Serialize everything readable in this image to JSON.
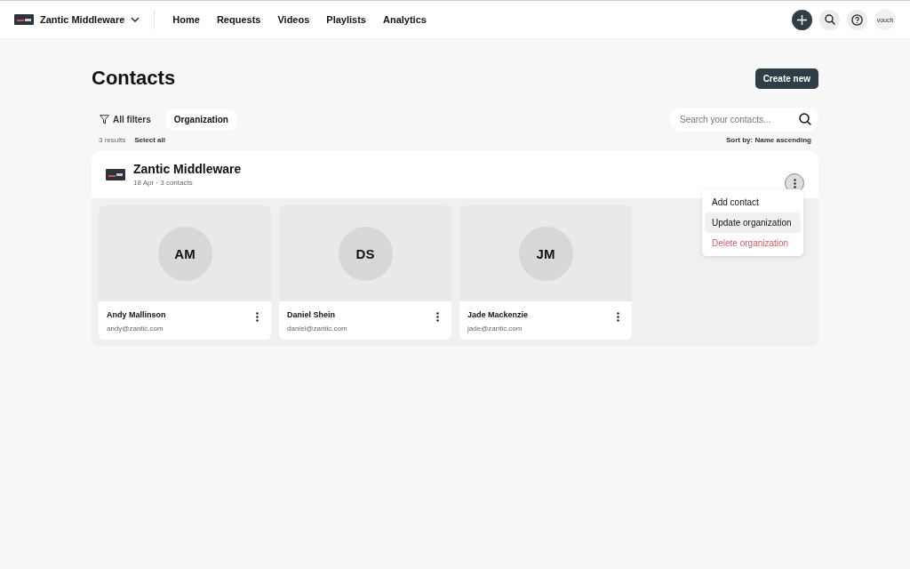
{
  "topbar": {
    "workspace": "Zantic Middleware",
    "nav": [
      "Home",
      "Requests",
      "Videos",
      "Playlists",
      "Analytics"
    ],
    "user": "vouch"
  },
  "page": {
    "title": "Contacts",
    "create_button": "Create new"
  },
  "filters": [
    {
      "label": "All filters",
      "kind": "filter",
      "selected": false
    },
    {
      "label": "Organization",
      "kind": "chip",
      "selected": true
    }
  ],
  "search": {
    "placeholder": "Search your contacts..."
  },
  "results": {
    "count": "3 results",
    "select_all": "Select all",
    "sort": "Sort by: Name ascending"
  },
  "organization": {
    "name": "Zantic Middleware",
    "meta": "18 Apr · 3 contacts",
    "menu": [
      {
        "label": "Add contact",
        "kind": "normal",
        "highlighted": false
      },
      {
        "label": "Update organization",
        "kind": "normal",
        "highlighted": true
      },
      {
        "label": "Delete organization",
        "kind": "danger",
        "highlighted": false
      }
    ],
    "contacts": [
      {
        "initials": "AM",
        "name": "Andy Mallinson",
        "email": "andy@zantic.com"
      },
      {
        "initials": "DS",
        "name": "Daniel Shein",
        "email": "daniel@zantic.com"
      },
      {
        "initials": "JM",
        "name": "Jade Mackenzie",
        "email": "jade@zantic.com"
      }
    ]
  }
}
